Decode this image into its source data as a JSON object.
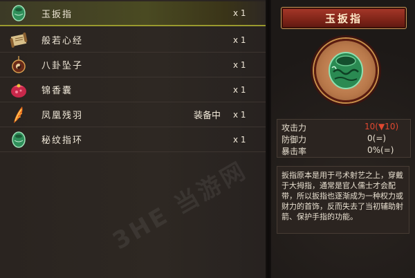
{
  "inventory": {
    "items": [
      {
        "name": "玉扳指",
        "status": "",
        "qty": "x 1",
        "icon": "jade-ring-icon"
      },
      {
        "name": "般若心经",
        "status": "",
        "qty": "x 1",
        "icon": "scroll-icon"
      },
      {
        "name": "八卦坠子",
        "status": "",
        "qty": "x 1",
        "icon": "bagua-pendant-icon"
      },
      {
        "name": "锦香囊",
        "status": "",
        "qty": "x 1",
        "icon": "sachet-icon"
      },
      {
        "name": "凤凰残羽",
        "status": "装备中",
        "qty": "x 1",
        "icon": "phoenix-feather-icon"
      },
      {
        "name": "秘纹指环",
        "status": "",
        "qty": "x 1",
        "icon": "jade-ring-icon"
      }
    ],
    "selected_index": 0
  },
  "detail": {
    "title": "玉扳指",
    "portrait_icon": "jade-ring-icon",
    "stats": [
      {
        "label": "攻击力",
        "value": "10(▼10)",
        "highlight": true
      },
      {
        "label": "防御力",
        "value": "0(=)",
        "highlight": false
      },
      {
        "label": "暴击率",
        "value": "0%(=)",
        "highlight": false
      }
    ],
    "description": "扳指原本是用于弓术射艺之上，穿戴于大拇指，通常是官人儒士才会配带，所以扳指也逐渐成为一种权力或财力的首饰，反而失去了当初辅助射箭、保护手指的功能。"
  },
  "watermark": {
    "text": "3HE 当游网"
  },
  "colors": {
    "selected_bar": "#9a9a2e",
    "title_plate": "#8e2a1c",
    "stat_highlight": "#e04830",
    "jade": "#3aa66a"
  }
}
